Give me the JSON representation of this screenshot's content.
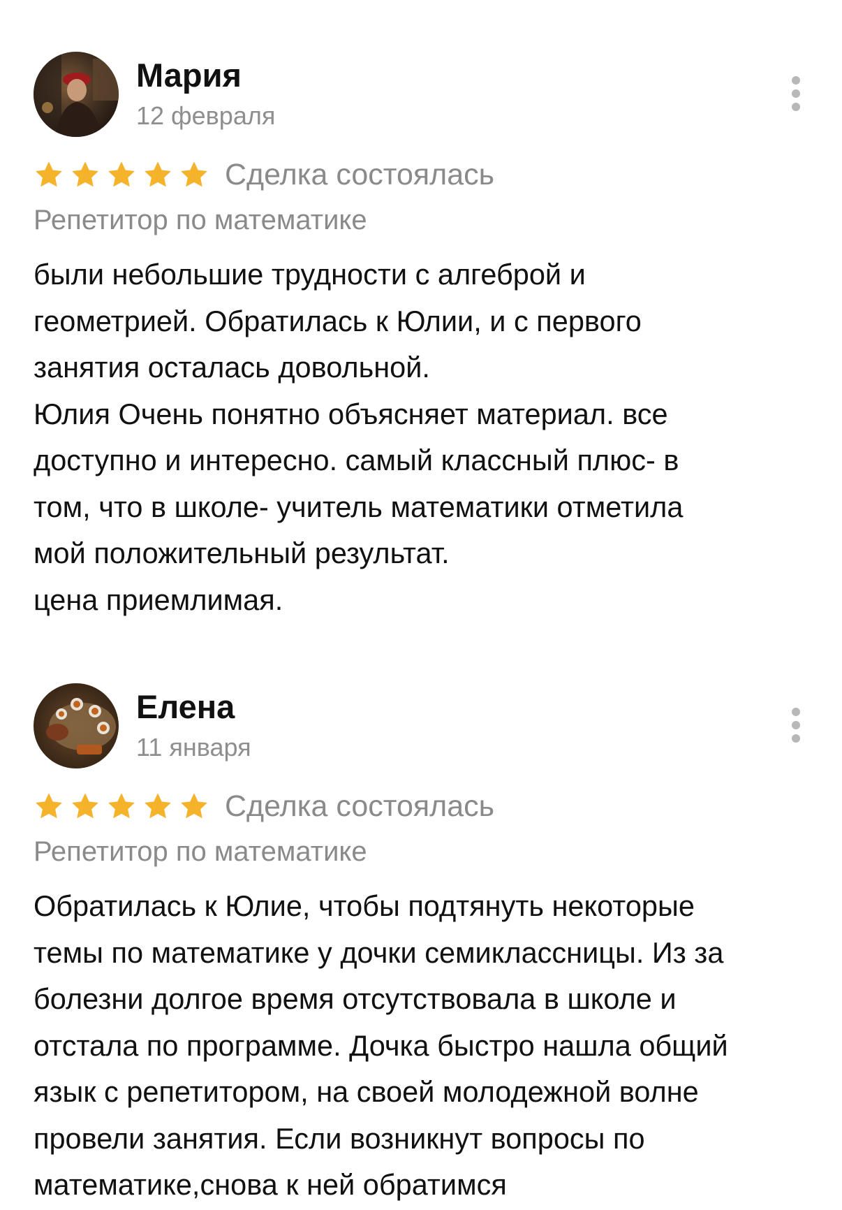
{
  "reviews": [
    {
      "author": "Мария",
      "date": "12 февраля",
      "rating": 5,
      "status": "Сделка состоялась",
      "service": "Репетитор по математике",
      "text_lines": [
        "были небольшие трудности с алгеброй и",
        "геометрией. Обратилась к Юлии, и с первого",
        "занятия осталась довольной.",
        "Юлия Очень понятно объясняет материал. все",
        "доступно и интересно. самый классный плюс- в",
        "том, что в школе- учитель математики отметила",
        "мой положительный результат.",
        "цена приемлимая."
      ]
    },
    {
      "author": "Елена",
      "date": "11 января",
      "rating": 5,
      "status": "Сделка состоялась",
      "service": "Репетитор по математике",
      "text_lines": [
        "Обратилась к  Юлие, чтобы подтянуть некоторые",
        "темы по математике у дочки семиклассницы. Из за",
        "болезни долгое время отсутствовала в школе и",
        "отстала по программе. Дочка быстро нашла общий",
        "язык с репетитором, на своей молодежной волне",
        "провели занятия. Если возникнут вопросы по",
        "математике,снова к ней обратимся"
      ]
    }
  ],
  "icons": {
    "star": "star-icon",
    "more": "more-vertical-icon"
  },
  "colors": {
    "star": "#f5b32c",
    "muted_text": "#8a8a8a",
    "main_text": "#111111",
    "more_dots": "#b8b8b8"
  }
}
